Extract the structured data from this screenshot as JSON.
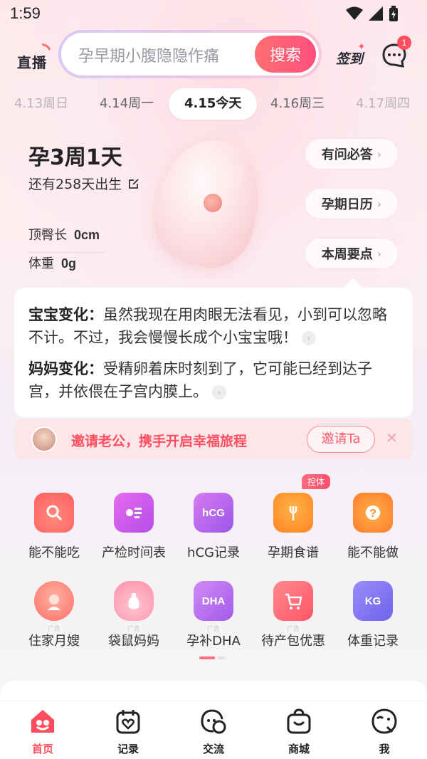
{
  "status": {
    "time": "1:59"
  },
  "header": {
    "live_label": "直播",
    "search_placeholder": "孕早期小腹隐隐作痛",
    "search_button": "搜索",
    "checkin_label": "签到",
    "message_badge": "1"
  },
  "dates": [
    {
      "label": "4.13周日"
    },
    {
      "label": "4.14周一"
    },
    {
      "label": "4.15今天"
    },
    {
      "label": "4.16周三"
    },
    {
      "label": "4.17周四"
    }
  ],
  "pregnancy": {
    "week_title": "孕3周1天",
    "remaining": "还有258天出生",
    "crl_label": "顶臀长",
    "crl_value": "0cm",
    "weight_label": "体重",
    "weight_value": "0g"
  },
  "quick_links": [
    {
      "label": "有问必答"
    },
    {
      "label": "孕期日历"
    },
    {
      "label": "本周要点"
    }
  ],
  "changes": {
    "baby_title": "宝宝变化：",
    "baby_text": "虽然我现在用肉眼无法看见，小到可以忽略不计。不过，我会慢慢长成个小宝宝哦！",
    "mom_title": "妈妈变化：",
    "mom_text": "受精卵着床时刻到了，它可能已经到达子宫，并依偎在子宫内膜上。"
  },
  "invite": {
    "text": "邀请老公，携手开启幸福旅程",
    "button": "邀请Ta"
  },
  "tools": [
    {
      "label": "能不能吃",
      "icon": "bowl-search-icon"
    },
    {
      "label": "产检时间表",
      "icon": "checkup-schedule-icon"
    },
    {
      "label": "hCG记录",
      "icon": "hcg-icon",
      "icon_text": "hCG"
    },
    {
      "label": "孕期食谱",
      "icon": "chef-hat-icon",
      "tag": "控体"
    },
    {
      "label": "能不能做",
      "icon": "hand-question-icon"
    },
    {
      "label": "住家月嫂",
      "icon": "nanny-icon",
      "ad": "广告"
    },
    {
      "label": "袋鼠妈妈",
      "icon": "bottle-icon",
      "ad": "广告"
    },
    {
      "label": "孕补DHA",
      "icon": "dha-jar-icon",
      "icon_text": "DHA",
      "ad": "广告"
    },
    {
      "label": "待产包优惠",
      "icon": "shopping-cart-icon",
      "ad": "广告"
    },
    {
      "label": "体重记录",
      "icon": "scale-icon",
      "icon_text": "KG"
    }
  ],
  "tabbar": [
    {
      "label": "首页",
      "icon": "home-icon"
    },
    {
      "label": "记录",
      "icon": "calendar-heart-icon"
    },
    {
      "label": "交流",
      "icon": "chat-bubbles-icon"
    },
    {
      "label": "商城",
      "icon": "shopping-bag-icon"
    },
    {
      "label": "我",
      "icon": "profile-face-icon"
    }
  ],
  "colors": {
    "accent": "#ff4f5e",
    "bg_pink": "#fde9ec"
  }
}
